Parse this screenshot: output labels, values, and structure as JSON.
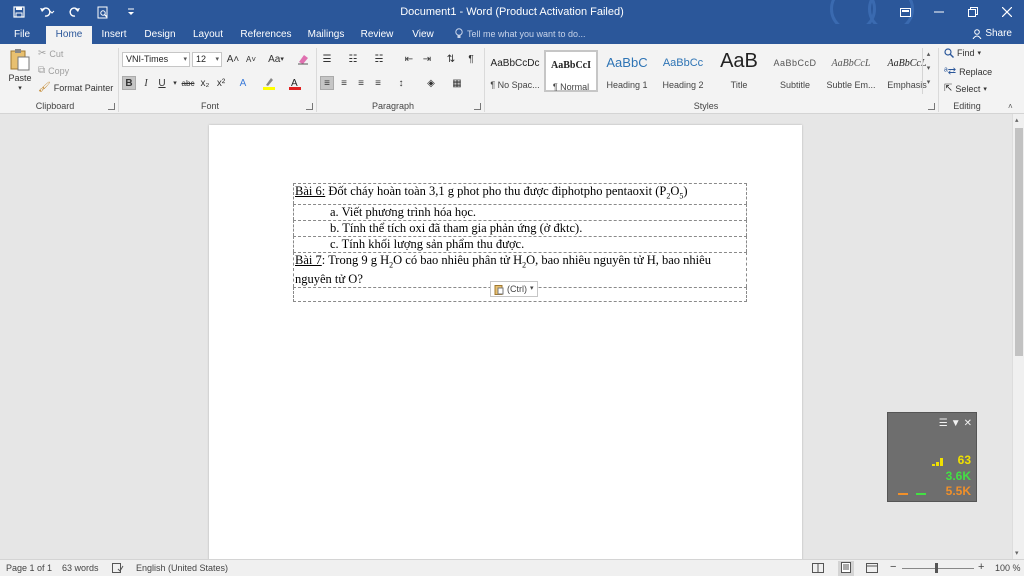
{
  "window": {
    "title": "Document1 - Word (Product Activation Failed)",
    "controls": [
      "ribbon-display-icon",
      "minimize-icon",
      "restore-icon",
      "close-icon"
    ]
  },
  "quick_access": [
    "save-icon",
    "undo-icon",
    "redo-icon",
    "print-preview-icon",
    "customize-icon"
  ],
  "tabs": [
    {
      "label": "File"
    },
    {
      "label": "Home",
      "active": true
    },
    {
      "label": "Insert"
    },
    {
      "label": "Design"
    },
    {
      "label": "Layout"
    },
    {
      "label": "References"
    },
    {
      "label": "Mailings"
    },
    {
      "label": "Review"
    },
    {
      "label": "View"
    }
  ],
  "tell_me": "Tell me what you want to do...",
  "share": "Share",
  "ribbon": {
    "clipboard": {
      "label": "Clipboard",
      "paste": "Paste",
      "cut": "Cut",
      "copy": "Copy",
      "format_painter": "Format Painter"
    },
    "font": {
      "label": "Font",
      "font_name": "VNI-Times",
      "font_size": "12",
      "change_case": "Aa"
    },
    "paragraph": {
      "label": "Paragraph"
    },
    "styles": {
      "label": "Styles",
      "items": [
        {
          "preview": "AaBbCcDc",
          "name": "¶ No Spac..."
        },
        {
          "preview": "AaBbCcI",
          "name": "¶ Normal",
          "selected": true
        },
        {
          "preview": "AaBbC",
          "name": "Heading 1"
        },
        {
          "preview": "AaBbCc",
          "name": "Heading 2"
        },
        {
          "preview": "AaB",
          "name": "Title"
        },
        {
          "preview": "AaBbCcD",
          "name": "Subtitle"
        },
        {
          "preview": "AaBbCcL",
          "name": "Subtle Em..."
        },
        {
          "preview": "AaBbCcL",
          "name": "Emphasis"
        }
      ]
    },
    "editing": {
      "label": "Editing",
      "find": "Find",
      "replace": "Replace",
      "select": "Select"
    }
  },
  "document": {
    "bai6_label": "Bài 6:",
    "bai6_text": "  Đốt cháy hoàn toàn 3,1 g phot pho thu được điphotpho pentaoxit (P",
    "bai6_sub1": "2",
    "bai6_mid": "O",
    "bai6_sub2": "5",
    "bai6_end": ")",
    "item_a": "a. Viết phương trình hóa học.",
    "item_b": "b. Tính thể tích oxi đã tham gia phản ứng (ở đktc).",
    "item_c": "c. Tính khối lượng sản phẩm thu được.",
    "bai7_label": "Bài 7",
    "bai7_t1": ": Trong 9 g H",
    "bai7_sub1": "2",
    "bai7_t2": "O có bao nhiêu phân tử H",
    "bai7_sub2": "2",
    "bai7_t3": "O, bao nhiêu nguyên tử H, bao nhiêu nguyên tử O?",
    "paste_options": "(Ctrl)"
  },
  "net_widget": {
    "v1": "63",
    "v2": "3.6K",
    "v3": "5.5K",
    "color_v1": "#f0e000",
    "color_v2": "#43e043",
    "color_v3": "#f0902a"
  },
  "status": {
    "page": "Page 1 of 1",
    "words": "63 words",
    "language": "English (United States)",
    "zoom": "100 %"
  }
}
